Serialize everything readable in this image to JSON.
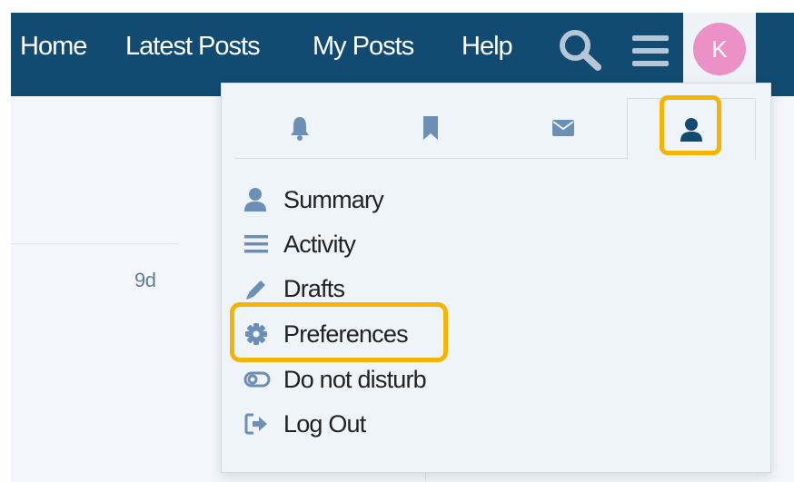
{
  "header": {
    "nav": [
      {
        "label": "Home"
      },
      {
        "label": "Latest Posts"
      },
      {
        "label": "My Posts"
      },
      {
        "label": "Help"
      }
    ],
    "avatar_letter": "K",
    "avatar_color": "#eb91c8",
    "bar_color": "#114b71"
  },
  "background": {
    "age": "9d"
  },
  "user_menu": {
    "tabs": [
      {
        "icon": "bell-icon"
      },
      {
        "icon": "bookmark-icon"
      },
      {
        "icon": "envelope-icon"
      },
      {
        "icon": "user-icon",
        "active": true
      }
    ],
    "items": [
      {
        "label": "Summary",
        "icon": "user-icon"
      },
      {
        "label": "Activity",
        "icon": "list-icon"
      },
      {
        "label": "Drafts",
        "icon": "pencil-icon"
      },
      {
        "label": "Preferences",
        "icon": "gear-icon",
        "highlighted": true
      },
      {
        "label": "Do not disturb",
        "icon": "toggle-icon"
      },
      {
        "label": "Log Out",
        "icon": "sign-out-icon"
      }
    ],
    "icon_color": "#6b8fb5",
    "highlight_color": "#f4b400"
  }
}
